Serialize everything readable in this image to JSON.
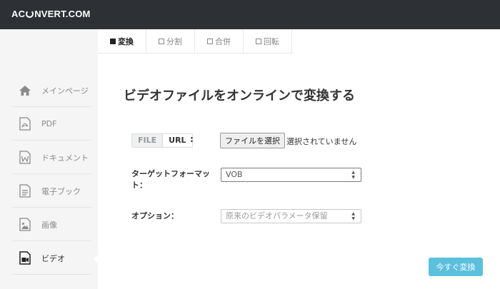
{
  "logo": {
    "before": "AC",
    "after": "NVERT.COM"
  },
  "tabs": [
    {
      "label": "変換",
      "active": true
    },
    {
      "label": "分割",
      "active": false
    },
    {
      "label": "合併",
      "active": false
    },
    {
      "label": "回転",
      "active": false
    }
  ],
  "sidebar": {
    "items": [
      {
        "label": "メインページ",
        "icon": "home-icon"
      },
      {
        "label": "PDF",
        "icon": "pdf-file-icon"
      },
      {
        "label": "ドキュメント",
        "icon": "word-document-icon"
      },
      {
        "label": "電子ブック",
        "icon": "ebook-icon"
      },
      {
        "label": "画像",
        "icon": "image-icon"
      },
      {
        "label": "ビデオ",
        "icon": "video-icon",
        "active": true
      }
    ]
  },
  "main": {
    "title": "ビデオファイルをオンラインで変換する",
    "source_switch": {
      "file": "FILE",
      "url": "URL",
      "colon": ":"
    },
    "file_button": "ファイルを選択",
    "file_status": "選択されていません",
    "format_label": "ターゲットフォーマット：",
    "format_value": "VOB",
    "option_label": "オプション：",
    "option_value": "原来のビデオパラメータ保留",
    "convert_button": "今すぐ変換"
  },
  "colors": {
    "topbar": "#2d3035",
    "accent": "#5bc0de",
    "sidebar": "#f5f5f5"
  }
}
